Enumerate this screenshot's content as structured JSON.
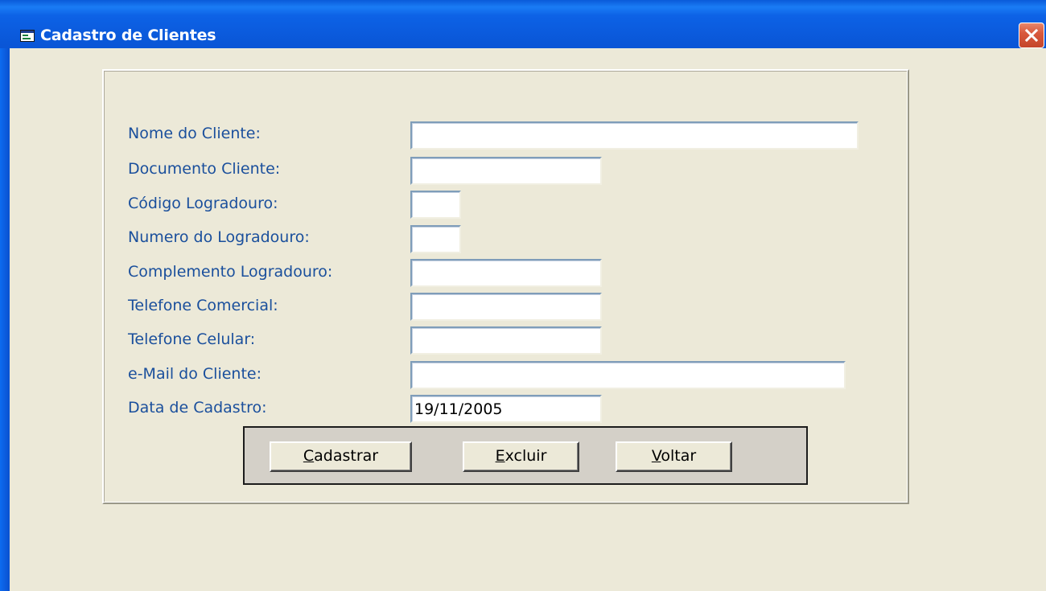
{
  "window": {
    "title": "Cadastro de Clientes",
    "title_icon": "form-window-icon",
    "close_icon": "close-icon"
  },
  "form": {
    "fields": [
      {
        "label": "Nome do Cliente:",
        "value": ""
      },
      {
        "label": "Documento Cliente:",
        "value": ""
      },
      {
        "label": "Código Logradouro:",
        "value": ""
      },
      {
        "label": "Numero do Logradouro:",
        "value": ""
      },
      {
        "label": "Complemento Logradouro:",
        "value": ""
      },
      {
        "label": "Telefone Comercial:",
        "value": ""
      },
      {
        "label": "Telefone Celular:",
        "value": ""
      },
      {
        "label": "e-Mail do Cliente:",
        "value": ""
      },
      {
        "label": "Data de Cadastro:",
        "value": "19/11/2005"
      }
    ]
  },
  "buttons": {
    "cadastrar": {
      "accel": "C",
      "rest": "adastrar"
    },
    "excluir": {
      "accel": "E",
      "rest": "xcluir"
    },
    "voltar": {
      "accel": "V",
      "rest": "oltar"
    }
  },
  "colors": {
    "title_bar": "#0a57d8",
    "client_bg": "#ece9d8",
    "label_text": "#1a4f9c",
    "close_button": "#d9593d"
  }
}
